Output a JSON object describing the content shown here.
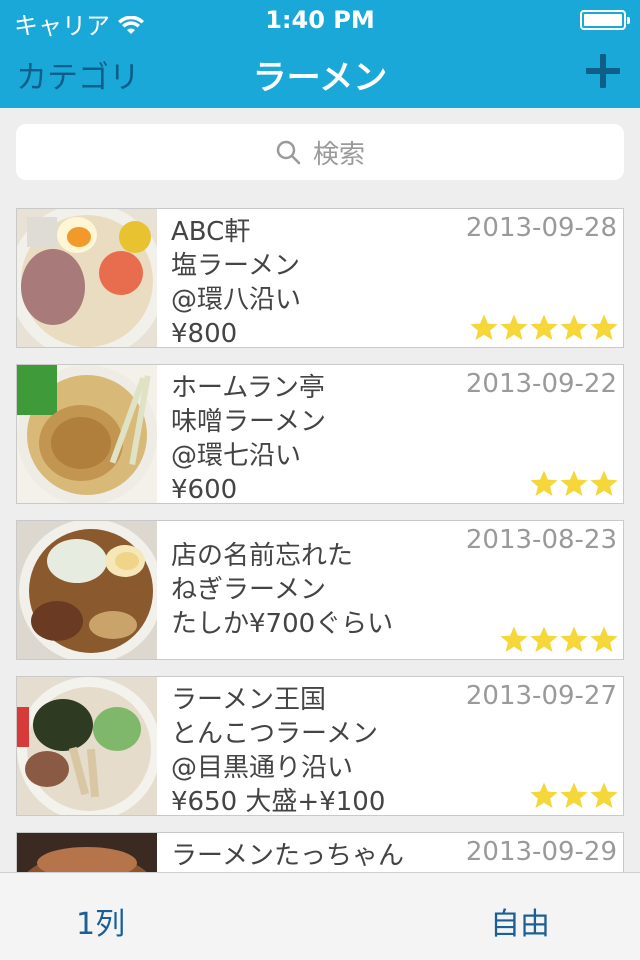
{
  "status_bar": {
    "carrier": "キャリア",
    "time": "1:40 PM"
  },
  "nav": {
    "back_label": "カテゴリ",
    "title": "ラーメン",
    "add_icon": "plus-icon"
  },
  "search": {
    "placeholder": "検索",
    "icon": "search-icon"
  },
  "colors": {
    "bar": "#1aa8d8",
    "nav_button": "#0d5f8a",
    "star": "#f5d73a",
    "tab_text": "#1c5f94"
  },
  "items": [
    {
      "line1": "ABC軒",
      "line2": "塩ラーメン",
      "line3": "@環八沿い",
      "line4": "¥800",
      "date": "2013-09-28",
      "rating": 5
    },
    {
      "line1": "ホームラン亭",
      "line2": "味噌ラーメン",
      "line3": "@環七沿い",
      "line4": "¥600",
      "date": "2013-09-22",
      "rating": 3
    },
    {
      "line1": "店の名前忘れた",
      "line2": "ねぎラーメン",
      "line3": "たしか¥700ぐらい",
      "line4": "",
      "date": "2013-08-23",
      "rating": 4
    },
    {
      "line1": "ラーメン王国",
      "line2": "とんこつラーメン",
      "line3": "@目黒通り沿い",
      "line4": "¥650 大盛+¥100",
      "date": "2013-09-27",
      "rating": 3
    },
    {
      "line1": "ラーメンたっちゃん",
      "line2": "",
      "line3": "",
      "line4": "",
      "date": "2013-09-29",
      "rating": 0
    }
  ],
  "tab_bar": {
    "left_label": "1列",
    "right_label": "自由"
  }
}
